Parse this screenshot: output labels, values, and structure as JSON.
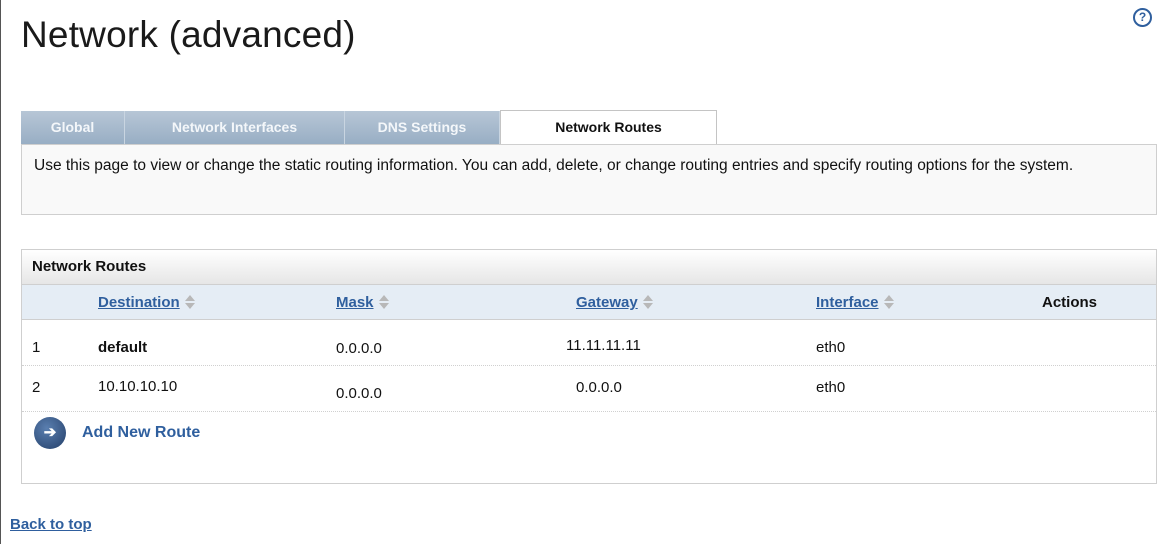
{
  "page": {
    "title": "Network (advanced)",
    "help_glyph": "?",
    "back_to_top": "Back to top"
  },
  "tabs": [
    {
      "label": "Global",
      "active": false
    },
    {
      "label": "Network Interfaces",
      "active": false
    },
    {
      "label": "DNS Settings",
      "active": false
    },
    {
      "label": "Network Routes",
      "active": true
    }
  ],
  "intro_text": "Use this page to view or change the static routing information. You can add, delete, or change routing entries and specify routing options for the system.",
  "routes_panel": {
    "title": "Network Routes",
    "columns": {
      "destination": "Destination",
      "mask": "Mask",
      "gateway": "Gateway",
      "interface": "Interface",
      "actions": "Actions"
    },
    "rows": [
      {
        "index": "1",
        "destination": "default",
        "mask": "0.0.0.0",
        "gateway": "11.11.11.11",
        "interface": "eth0"
      },
      {
        "index": "2",
        "destination": "10.10.10.10",
        "mask": "0.0.0.0",
        "gateway": "0.0.0.0",
        "interface": "eth0"
      }
    ],
    "add_label": "Add New Route",
    "add_glyph": "➔"
  },
  "colors": {
    "link": "#2f5f9e",
    "tab_inactive": "#a6b9cc",
    "header_row": "#e5edf5"
  }
}
